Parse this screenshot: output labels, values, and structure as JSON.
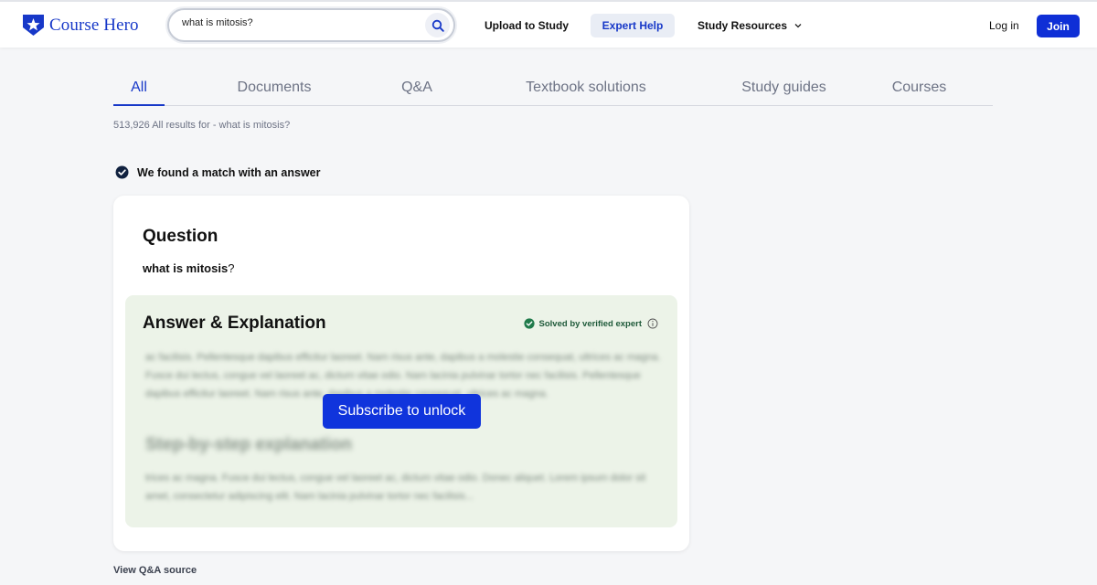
{
  "colors": {
    "brand": "#1738c8",
    "primary_button": "#0f2fd6",
    "answer_bg": "#ecf3e8",
    "verified_green": "#1f7a4a"
  },
  "header": {
    "logo_text": "Course Hero",
    "logo_icon": "star-shield-icon",
    "search_value": "what is mitosis?",
    "search_icon": "search-icon",
    "upload_label": "Upload to Study",
    "expert_label": "Expert Help",
    "resources_label": "Study Resources",
    "login_label": "Log in",
    "join_label": "Join"
  },
  "tabs": [
    {
      "label": "All",
      "active": true
    },
    {
      "label": "Documents",
      "active": false
    },
    {
      "label": "Q&A",
      "active": false
    },
    {
      "label": "Textbook solutions",
      "active": false
    },
    {
      "label": "Study guides",
      "active": false
    },
    {
      "label": "Courses",
      "active": false
    }
  ],
  "results_text": "513,926 All results for - what is mitosis?",
  "match_text": "We found a match with an answer",
  "question": {
    "title": "Question",
    "text_bold": "what is mitosis",
    "text_rest": "?"
  },
  "answer": {
    "title": "Answer & Explanation",
    "verified_text": "Solved by verified expert",
    "blurred_paragraph_1": "ac facilisis. Pellentesque dapibus efficitur laoreet. Nam risus ante, dapibus a molestie consequat, ultrices ac magna. Fusce dui lectus, congue vel laoreet ac, dictum vitae odio. Nam lacinia pulvinar tortor nec facilisis. Pellentesque dapibus efficitur laoreet. Nam risus ante, dapibus a molestie consequat, ultrices ac magna.",
    "blurred_heading": "Step-by-step explanation",
    "blurred_paragraph_2": "trices ac magna. Fusce dui lectus, congue vel laoreet ac, dictum vitae odio. Donec aliquet. Lorem ipsum dolor sit amet, consectetur adipiscing elit. Nam lacinia pulvinar tortor nec facilisis...",
    "unlock_label": "Subscribe to unlock"
  },
  "view_source_label": "View Q&A source"
}
